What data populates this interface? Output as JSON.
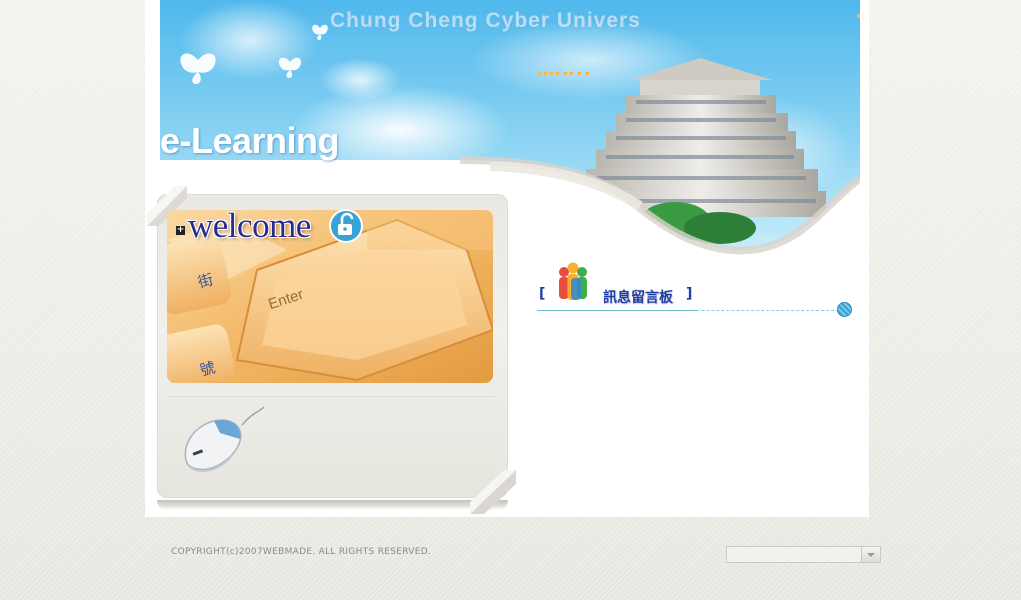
{
  "header": {
    "title": "Chung Cheng Cyber Univers",
    "subtitle": "e-Learning"
  },
  "welcome_panel": {
    "heading": "welcome",
    "plus_mark": "+",
    "keyboard_key_enter": "Enter",
    "keyboard_key_street": "街",
    "keyboard_key_number": "號"
  },
  "message_board": {
    "bracket_left": "[",
    "title": "訊息留言板",
    "bracket_right": "]"
  },
  "footer": {
    "copyright": "COPYRIGHT(c)2007WEBMADE. ALL RIGHTS RESERVED.",
    "select_value": ""
  },
  "colors": {
    "banner_sky": "#6cc6f0",
    "accent_blue": "#1f3fa8",
    "line_cyan": "#6fb9d8",
    "panel_bg": "#ecebe5",
    "keyboard_orange": "#f1b565"
  }
}
